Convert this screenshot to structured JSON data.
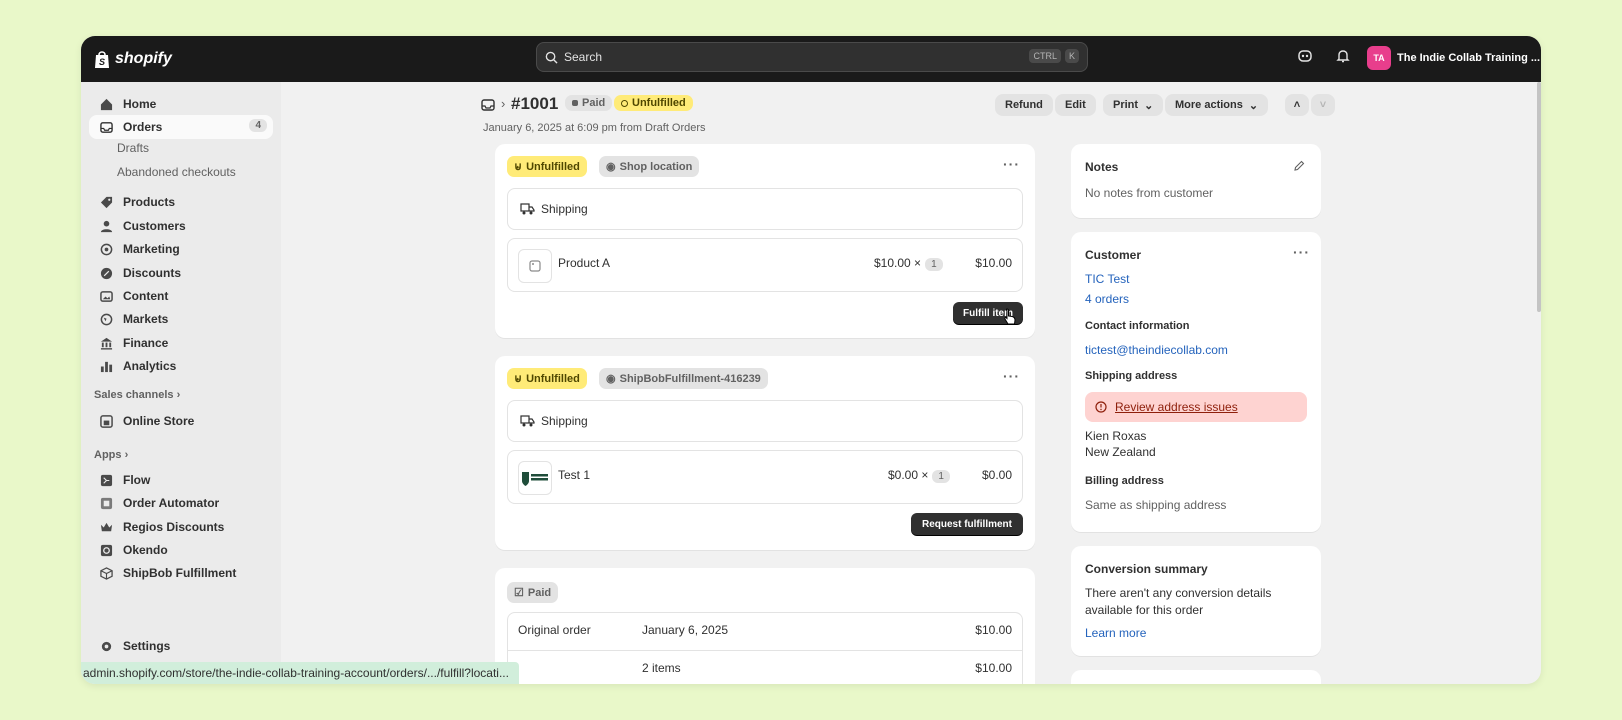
{
  "topbar": {
    "logo_text": "shopify",
    "search_placeholder": "Search",
    "kbd_ctrl": "CTRL",
    "kbd_k": "K",
    "avatar_initials": "TA",
    "store_name": "The Indie Collab Training ..."
  },
  "sidebar": {
    "home": "Home",
    "orders": "Orders",
    "orders_count": "4",
    "drafts": "Drafts",
    "abandoned": "Abandoned checkouts",
    "products": "Products",
    "customers": "Customers",
    "marketing": "Marketing",
    "discounts": "Discounts",
    "content": "Content",
    "markets": "Markets",
    "finance": "Finance",
    "analytics": "Analytics",
    "sales_channels": "Sales channels",
    "online_store": "Online Store",
    "apps": "Apps",
    "flow": "Flow",
    "order_automator": "Order Automator",
    "regios": "Regios Discounts",
    "okendo": "Okendo",
    "shipbob": "ShipBob Fulfillment",
    "settings": "Settings"
  },
  "status_url": "admin.shopify.com/store/the-indie-collab-training-account/orders/.../fulfill?locati...",
  "header": {
    "order_number": "#1001",
    "paid_badge": "Paid",
    "unfulfilled_badge": "Unfulfilled",
    "subtitle": "January 6, 2025 at 6:09 pm from Draft Orders",
    "refund": "Refund",
    "edit": "Edit",
    "print": "Print",
    "more_actions": "More actions"
  },
  "fulfillment1": {
    "status": "Unfulfilled",
    "location": "Shop location",
    "shipping": "Shipping",
    "product": "Product A",
    "price": "$10.00",
    "times": "×",
    "qty": "1",
    "total": "$10.00",
    "button": "Fulfill item"
  },
  "fulfillment2": {
    "status": "Unfulfilled",
    "location": "ShipBobFulfillment-416239",
    "shipping": "Shipping",
    "product": "Test 1",
    "price": "$0.00",
    "times": "×",
    "qty": "1",
    "total": "$0.00",
    "button": "Request fulfillment"
  },
  "payment": {
    "status": "Paid",
    "row1_label": "Original order",
    "row1_mid": "January 6, 2025",
    "row1_value": "$10.00",
    "row2_mid": "2 items",
    "row2_value": "$10.00"
  },
  "notes": {
    "title": "Notes",
    "text": "No notes from customer"
  },
  "customer": {
    "title": "Customer",
    "name": "TIC Test",
    "orders": "4 orders",
    "contact_title": "Contact information",
    "email": "tictest@theindiecollab.com",
    "shipping_title": "Shipping address",
    "review": "Review address issues",
    "addr1": "Kien Roxas",
    "addr2": "New Zealand",
    "billing_title": "Billing address",
    "billing_text": "Same as shipping address"
  },
  "conversion": {
    "title": "Conversion summary",
    "text1": "There aren't any conversion details",
    "text2": "available for this order",
    "learn": "Learn more"
  }
}
